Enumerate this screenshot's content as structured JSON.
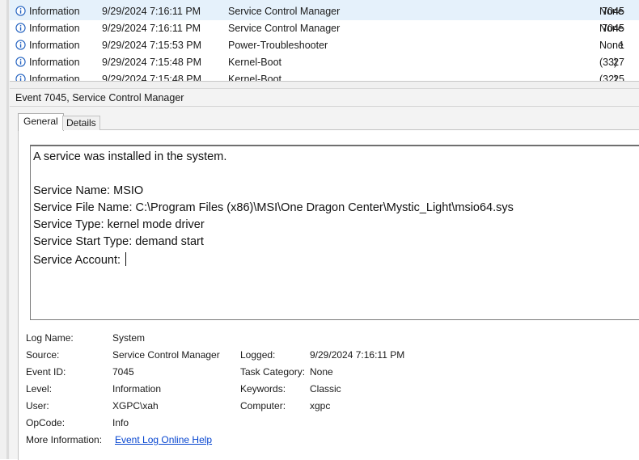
{
  "events": [
    {
      "level": "Information",
      "date": "9/29/2024 7:16:11 PM",
      "source": "Service Control Manager",
      "id": "7045",
      "task": "None",
      "selected": true
    },
    {
      "level": "Information",
      "date": "9/29/2024 7:16:11 PM",
      "source": "Service Control Manager",
      "id": "7045",
      "task": "None",
      "selected": false
    },
    {
      "level": "Information",
      "date": "9/29/2024 7:15:53 PM",
      "source": "Power-Troubleshooter",
      "id": "1",
      "task": "None",
      "selected": false
    },
    {
      "level": "Information",
      "date": "9/29/2024 7:15:48 PM",
      "source": "Kernel-Boot",
      "id": "27",
      "task": "(33)",
      "selected": false
    },
    {
      "level": "Information",
      "date": "9/29/2024 7:15:48 PM",
      "source": "Kernel-Boot",
      "id": "25",
      "task": "(32)",
      "selected": false
    }
  ],
  "detail": {
    "title": "Event 7045, Service Control Manager",
    "tabs": {
      "general": "General",
      "details": "Details"
    },
    "message": {
      "line1": "A service was installed in the system.",
      "service_name": "Service Name:  MSIO",
      "service_file": "Service File Name:  C:\\Program Files (x86)\\MSI\\One Dragon Center\\Mystic_Light\\msio64.sys",
      "service_type": "Service Type:  kernel mode driver",
      "start_type": "Service Start Type:  demand start",
      "account": "Service Account: "
    },
    "props": {
      "log_name_label": "Log Name:",
      "log_name": "System",
      "source_label": "Source:",
      "source": "Service Control Manager",
      "logged_label": "Logged:",
      "logged": "9/29/2024 7:16:11 PM",
      "event_id_label": "Event ID:",
      "event_id": "7045",
      "task_label": "Task Category:",
      "task": "None",
      "level_label": "Level:",
      "level": "Information",
      "keywords_label": "Keywords:",
      "keywords": "Classic",
      "user_label": "User:",
      "user": "XGPC\\xah",
      "computer_label": "Computer:",
      "computer": "xgpc",
      "opcode_label": "OpCode:",
      "opcode": "Info",
      "more_info_label": "More Information:",
      "more_info_link": "Event Log Online Help"
    }
  },
  "colors": {
    "selected_row": "#e5f1fb",
    "info_icon": "#1f5fbf",
    "link": "#0645d0"
  }
}
